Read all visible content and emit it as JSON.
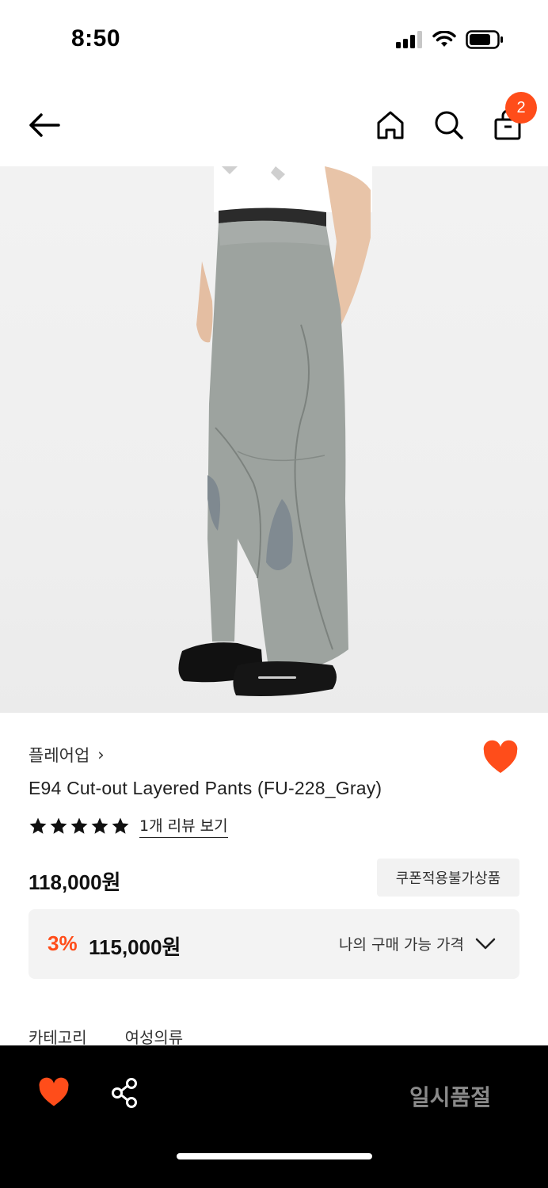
{
  "status_bar": {
    "time": "8:50"
  },
  "header": {
    "cart_count": "2"
  },
  "product": {
    "brand": "플레어업",
    "brand_chevron": "›",
    "name": "E94 Cut-out Layered Pants (FU-228_Gray)",
    "rating_stars": 5,
    "review_link": "1개 리뷰 보기",
    "price": "118,000원",
    "coupon_notice": "쿠폰적용불가상품",
    "discount_rate": "3%",
    "discount_price": "115,000원",
    "my_price_label": "나의 구매 가능 가격",
    "category_label": "카테고리",
    "category_value": "여성의류"
  },
  "bottom_bar": {
    "sold_out_label": "일시품절"
  },
  "colors": {
    "accent": "#ff4d1a",
    "bottom_bar_bg": "#000000",
    "sold_out_text": "#8a8a8a"
  },
  "icons": [
    "back-arrow-icon",
    "home-icon",
    "search-icon",
    "shopping-bag-icon",
    "heart-icon",
    "star-icon",
    "chevron-down-icon",
    "share-icon"
  ]
}
